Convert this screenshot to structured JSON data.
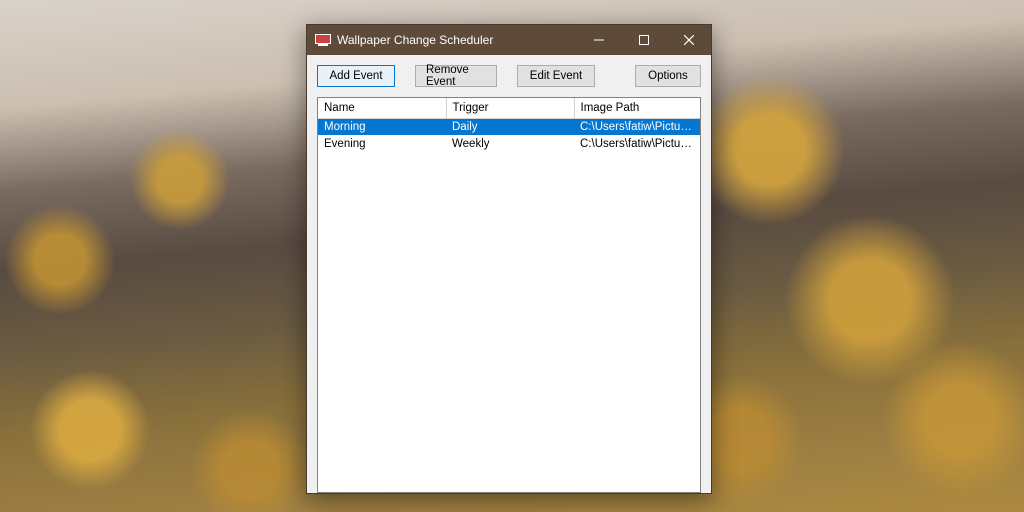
{
  "window": {
    "title": "Wallpaper Change Scheduler"
  },
  "toolbar": {
    "add_event": "Add Event",
    "remove_event": "Remove Event",
    "edit_event": "Edit Event",
    "options": "Options"
  },
  "table": {
    "columns": {
      "name": "Name",
      "trigger": "Trigger",
      "image_path": "Image Path"
    },
    "rows": [
      {
        "name": "Morning",
        "trigger": "Daily",
        "image_path": "C:\\Users\\fatiw\\Pictures\\wall...",
        "selected": true
      },
      {
        "name": "Evening",
        "trigger": "Weekly",
        "image_path": "C:\\Users\\fatiw\\Pictures\\wall...",
        "selected": false
      }
    ]
  }
}
